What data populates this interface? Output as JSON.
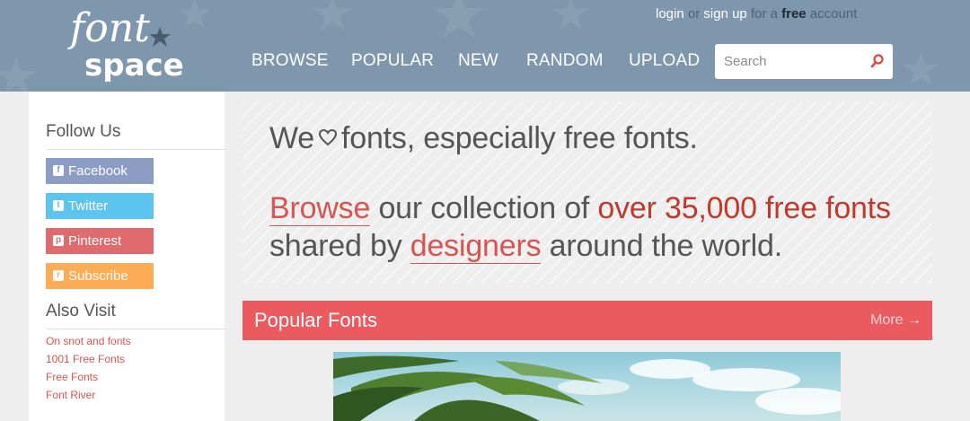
{
  "header": {
    "logo_text_top": "font",
    "logo_text_bottom": "space",
    "account": {
      "login": "login",
      "or": "or",
      "signup": "sign up",
      "for_a": "for a",
      "free": "free",
      "account": "account"
    },
    "nav": [
      "BROWSE",
      "POPULAR",
      "NEW",
      "RANDOM",
      "UPLOAD"
    ],
    "search_placeholder": "Search"
  },
  "sidebar": {
    "follow_title": "Follow Us",
    "social": [
      {
        "label": "Facebook",
        "icon": "facebook-icon",
        "glyph": "f"
      },
      {
        "label": "Twitter",
        "icon": "twitter-icon",
        "glyph": "t"
      },
      {
        "label": "Pinterest",
        "icon": "pinterest-icon",
        "glyph": "p"
      },
      {
        "label": "Subscribe",
        "icon": "rss-icon",
        "glyph": "r"
      }
    ],
    "also_title": "Also Visit",
    "links": [
      "On snot and fonts",
      "1001 Free Fonts",
      "Free Fonts",
      "Font River"
    ]
  },
  "hero": {
    "line1_a": "We",
    "line1_b": "fonts, especially free fonts.",
    "line2_browse": "Browse",
    "line2_mid": "our collection of",
    "line2_red": "over 35,000 free fonts",
    "line3_a": "shared by",
    "line3_designers": "designers",
    "line3_b": "around the world."
  },
  "popular": {
    "title": "Popular Fonts",
    "more": "More →"
  },
  "colors": {
    "header_bg": "#7f97ad",
    "accent_red": "#ea5a5f",
    "facebook": "#8b9dc3",
    "twitter": "#5bc5f0",
    "pinterest": "#df6b6e",
    "subscribe": "#fbac55"
  }
}
